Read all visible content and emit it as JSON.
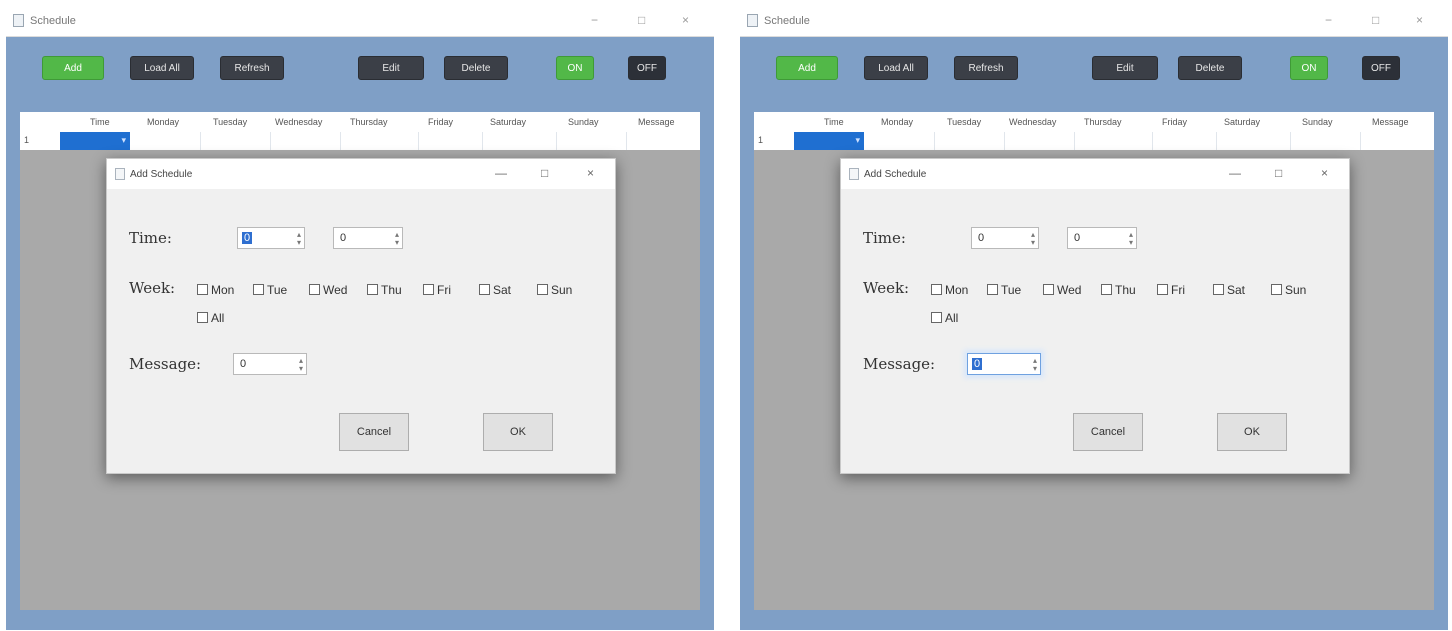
{
  "screens": [
    {
      "window": {
        "title": "Schedule",
        "min": "−",
        "max": "□",
        "close": "×"
      },
      "toolbar": [
        "Add",
        "Load All",
        "Refresh",
        "Edit",
        "Delete",
        "ON",
        "OFF"
      ],
      "grid": {
        "columns": [
          "Time",
          "Monday",
          "Tuesday",
          "Wednesday",
          "Thursday",
          "Friday",
          "Saturday",
          "Sunday",
          "Message"
        ],
        "row_number": "1"
      },
      "dialog": {
        "title": "Add Schedule",
        "min": "—",
        "max": "□",
        "close": "×",
        "time_label": "Time:",
        "hour": "0",
        "minute": "0",
        "week_label": "Week:",
        "days": [
          "Mon",
          "Tue",
          "Wed",
          "Thu",
          "Fri",
          "Sat",
          "Sun",
          "All"
        ],
        "message_label": "Message:",
        "message": "0",
        "cancel": "Cancel",
        "ok": "OK"
      }
    },
    {
      "window": {
        "title": "Schedule",
        "min": "−",
        "max": "□",
        "close": "×"
      },
      "toolbar": [
        "Add",
        "Load All",
        "Refresh",
        "Edit",
        "Delete",
        "ON",
        "OFF"
      ],
      "grid": {
        "columns": [
          "Time",
          "Monday",
          "Tuesday",
          "Wednesday",
          "Thursday",
          "Friday",
          "Saturday",
          "Sunday",
          "Message"
        ],
        "row_number": "1"
      },
      "dialog": {
        "title": "Add Schedule",
        "min": "—",
        "max": "□",
        "close": "×",
        "time_label": "Time:",
        "hour": "0",
        "minute": "0",
        "week_label": "Week:",
        "days": [
          "Mon",
          "Tue",
          "Wed",
          "Thu",
          "Fri",
          "Sat",
          "Sun",
          "All"
        ],
        "message_label": "Message:",
        "message": "0",
        "cancel": "Cancel",
        "ok": "OK"
      }
    }
  ],
  "colors": {
    "window_frame": "#7f9fc6",
    "workspace": "#a9a9a9",
    "selection": "#1f6fd1",
    "green_button": "#52b848",
    "dark_button": "#2c3038"
  }
}
